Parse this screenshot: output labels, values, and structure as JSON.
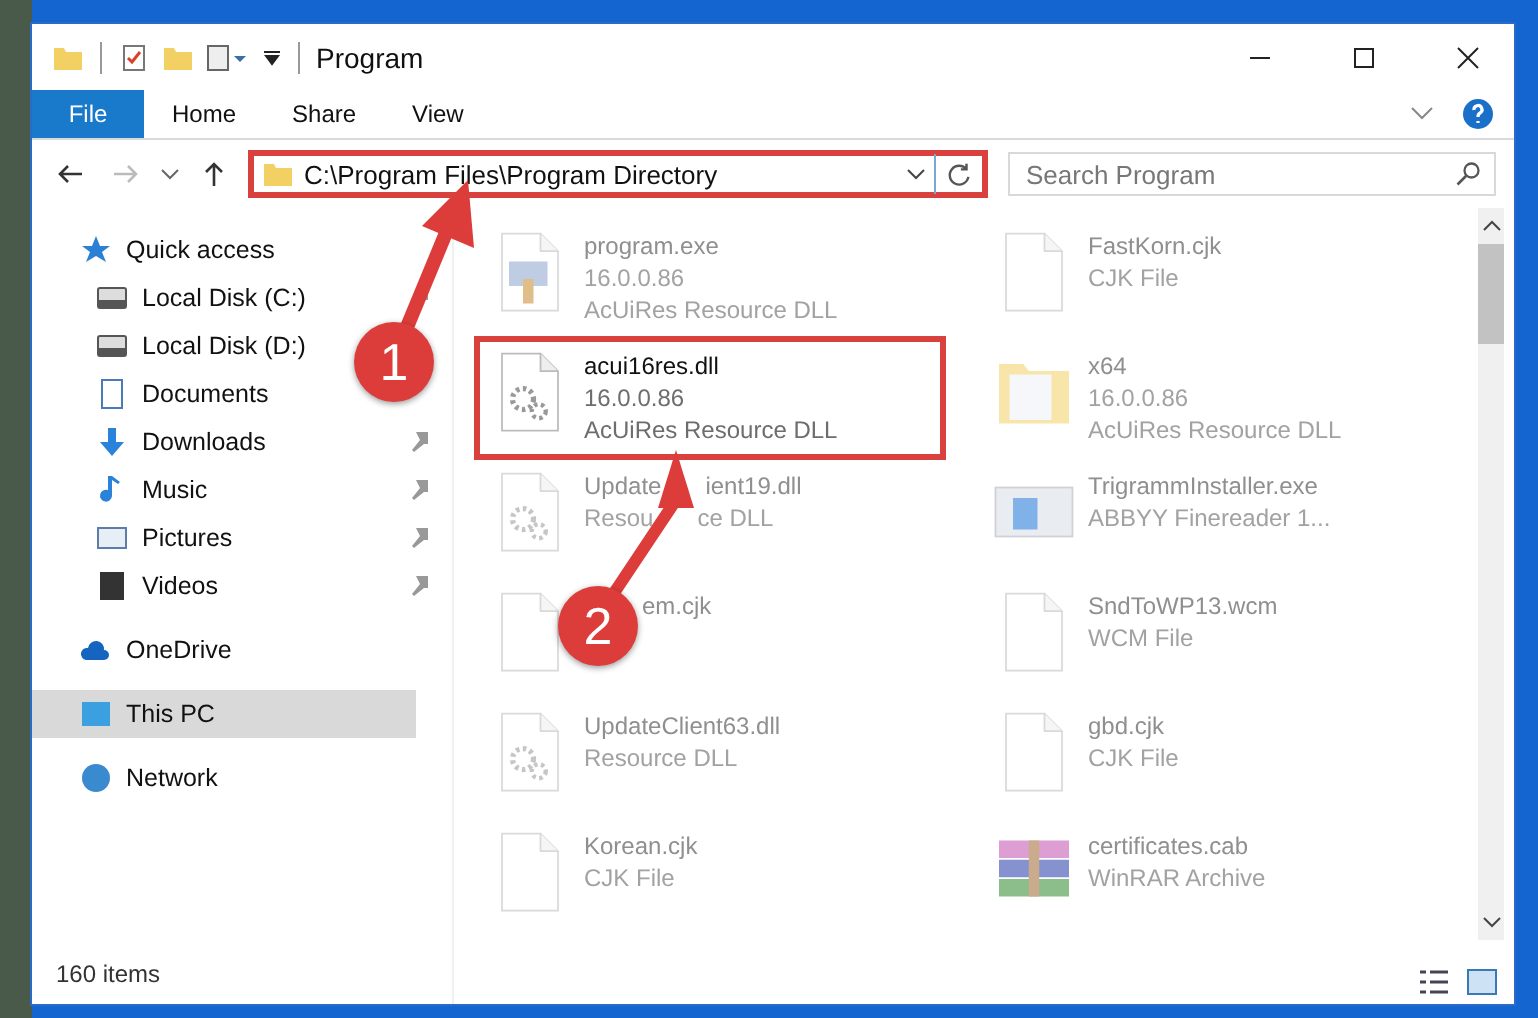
{
  "window": {
    "title": "Program"
  },
  "ribbon": {
    "file_button": "File",
    "tabs": [
      "Home",
      "Share",
      "View"
    ]
  },
  "address_bar": {
    "path": "C:\\Program Files\\Program Directory",
    "highlighted": true
  },
  "search": {
    "placeholder": "Search Program"
  },
  "nav": [
    {
      "label": "Quick access",
      "kind": "star",
      "selected": false,
      "children": [
        {
          "label": "Local Disk (C:)",
          "kind": "drive",
          "pinned": true,
          "selected": false
        },
        {
          "label": "Local Disk (D:)",
          "kind": "drive",
          "pinned": false,
          "selected": false
        },
        {
          "label": "Documents",
          "kind": "documents",
          "pinned": false,
          "selected": false
        },
        {
          "label": "Downloads",
          "kind": "downloads",
          "pinned": true,
          "selected": false
        },
        {
          "label": "Music",
          "kind": "music",
          "pinned": true,
          "selected": false
        },
        {
          "label": "Pictures",
          "kind": "pictures",
          "pinned": true,
          "selected": false
        },
        {
          "label": "Videos",
          "kind": "videos",
          "pinned": true,
          "selected": false
        }
      ]
    },
    {
      "label": "OneDrive",
      "kind": "cloud",
      "selected": false
    },
    {
      "label": "This PC",
      "kind": "pc",
      "selected": true
    },
    {
      "label": "Network",
      "kind": "network",
      "selected": false
    }
  ],
  "files": [
    {
      "name": [
        "program.exe"
      ],
      "details": [
        [
          "16.0.0.86"
        ],
        [
          "AcUiRes Resource DLL"
        ]
      ],
      "kind": "exe",
      "highlighted": false
    },
    {
      "name": [
        "FastKorn.cjk"
      ],
      "details": [
        [
          "CJK File"
        ]
      ],
      "kind": "doc",
      "highlighted": false
    },
    {
      "name": [
        "acui16res.dll"
      ],
      "details": [
        [
          "16.0.0.86"
        ],
        [
          "AcUiRes Resource DLL"
        ]
      ],
      "kind": "gears",
      "highlighted": true
    },
    {
      "name": [
        "x64"
      ],
      "details": [
        [
          "16.0.0.86"
        ],
        [
          "AcUiRes Resource DLL"
        ]
      ],
      "kind": "folder",
      "highlighted": false
    },
    {
      "name": [
        "Update",
        "ient19.dll"
      ],
      "details": [
        [
          "Resou",
          "ce DLL"
        ]
      ],
      "kind": "gears",
      "highlighted": false
    },
    {
      "name": [
        "TrigrammInstaller.exe"
      ],
      "details": [
        [
          "ABBYY Finereader 1..."
        ]
      ],
      "kind": "installer",
      "highlighted": false
    },
    {
      "name": [
        "em.cjk"
      ],
      "covered_start": true,
      "kind": "doc",
      "highlighted": false
    },
    {
      "name": [
        "SndToWP13.wcm"
      ],
      "details": [
        [
          "WCM File"
        ]
      ],
      "kind": "doc",
      "highlighted": false
    },
    {
      "name": [
        "UpdateClient63.dll"
      ],
      "details": [
        [
          "Resource DLL"
        ]
      ],
      "kind": "gears",
      "highlighted": false
    },
    {
      "name": [
        "gbd.cjk"
      ],
      "details": [
        [
          "CJK File"
        ]
      ],
      "kind": "doc",
      "highlighted": false
    },
    {
      "name": [
        "Korean.cjk"
      ],
      "details": [
        [
          "CJK File"
        ]
      ],
      "kind": "doc",
      "highlighted": false
    },
    {
      "name": [
        "certificates.cab"
      ],
      "details": [
        [
          "WinRAR Archive"
        ]
      ],
      "kind": "archive",
      "highlighted": false
    }
  ],
  "status_bar": {
    "item_count": "160 items"
  },
  "callouts": [
    "1",
    "2"
  ]
}
